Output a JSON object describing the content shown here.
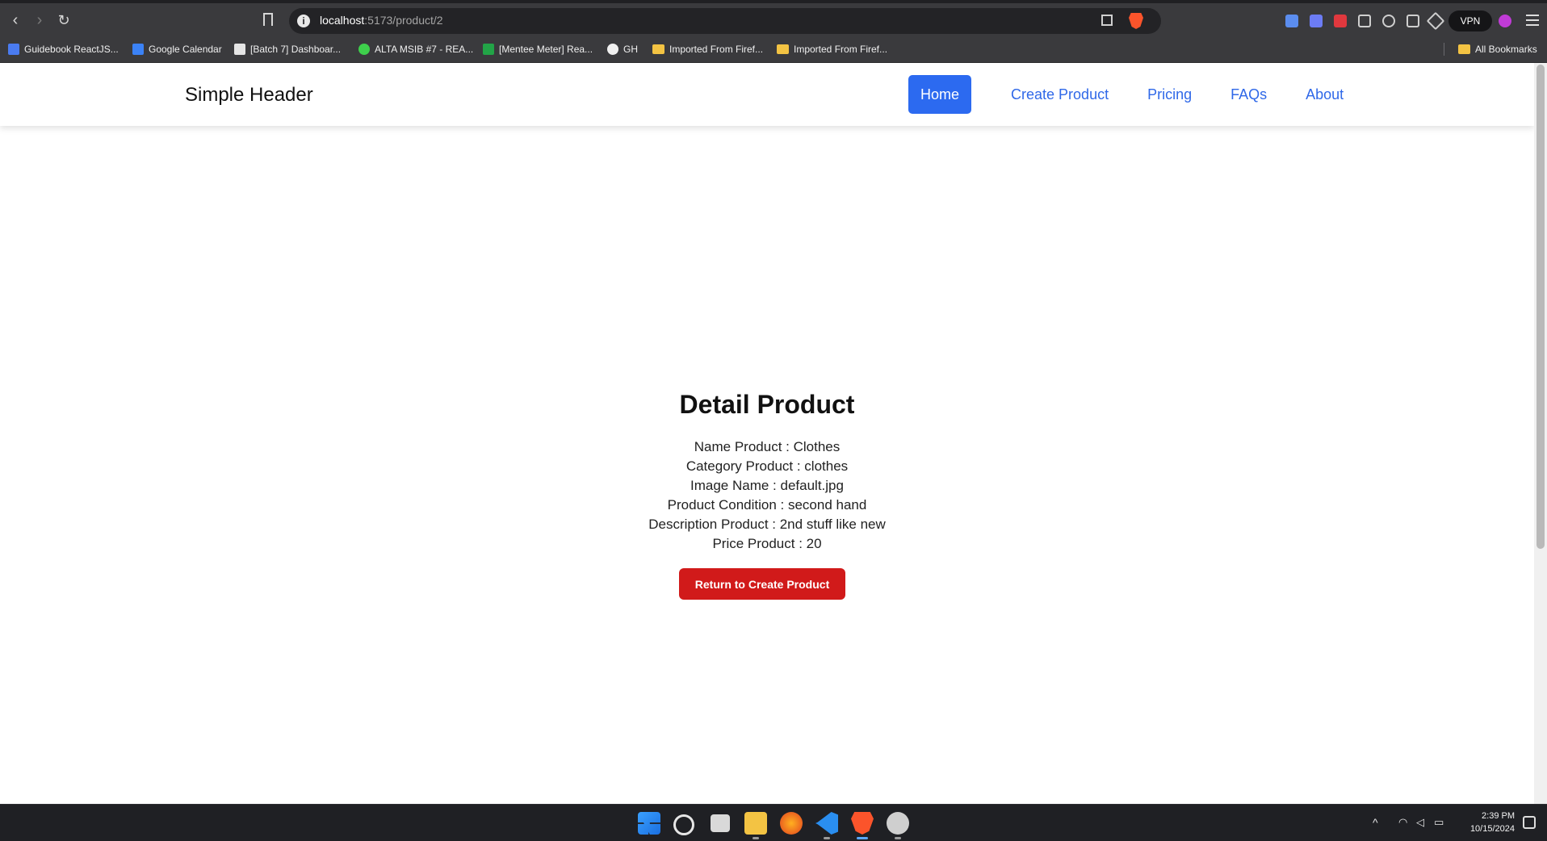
{
  "browser": {
    "url_host": "localhost",
    "url_path": ":5173/product/2",
    "vpn_label": "VPN",
    "bookmarks": [
      {
        "label": "Guidebook ReactJS...",
        "color": "#4a7bf0"
      },
      {
        "label": "Google Calendar",
        "color": "#3b82f6"
      },
      {
        "label": "[Batch 7] Dashboar...",
        "color": "#e5e5e5"
      },
      {
        "label": "ALTA MSIB #7 - REA...",
        "color": "#3ecf4c"
      },
      {
        "label": "[Mentee Meter] Rea...",
        "color": "#22a447"
      },
      {
        "label": "GH",
        "color": "#f0f0f0"
      },
      {
        "label": "Imported From Firef...",
        "color": "#f3c343"
      },
      {
        "label": "Imported From Firef...",
        "color": "#f3c343"
      }
    ],
    "all_bookmarks": "All Bookmarks"
  },
  "header": {
    "brand": "Simple Header",
    "nav": [
      {
        "label": "Home",
        "active": true
      },
      {
        "label": "Create Product",
        "active": false
      },
      {
        "label": "Pricing",
        "active": false
      },
      {
        "label": "FAQs",
        "active": false
      },
      {
        "label": "About",
        "active": false
      }
    ],
    "accent_color": "#2c6af0"
  },
  "detail": {
    "title": "Detail Product",
    "rows": [
      "Name Product : Clothes",
      "Category Product : clothes",
      "Image Name : default.jpg",
      "Product Condition : second hand",
      "Description Product : 2nd stuff like new",
      "Price Product : 20"
    ],
    "return_button": "Return to Create Product",
    "button_color": "#d11a1a"
  },
  "taskbar": {
    "time": "2:39 PM",
    "date": "10/15/2024"
  }
}
